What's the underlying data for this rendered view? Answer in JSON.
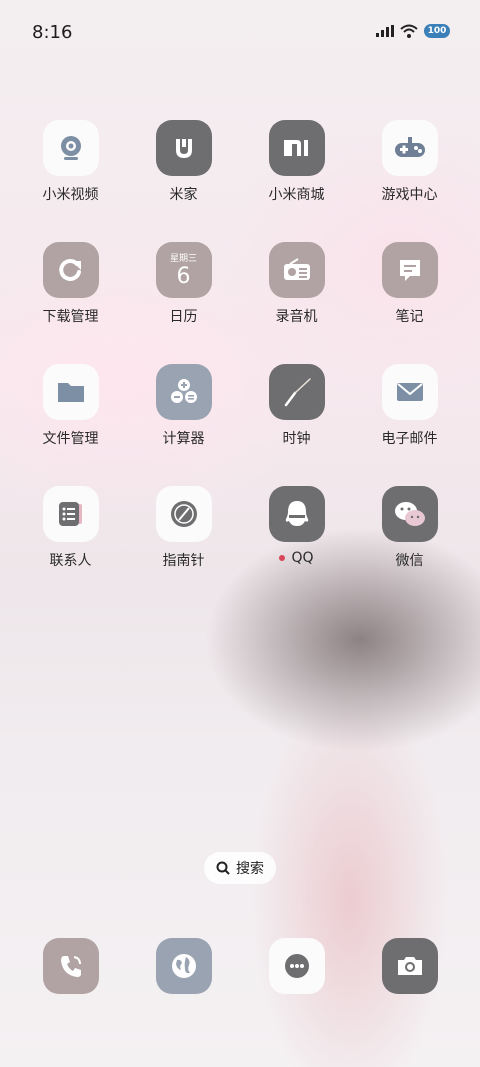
{
  "status": {
    "time": "8:16",
    "battery": "100"
  },
  "apps": [
    {
      "label": "小米视频",
      "icon": "camera-eye-icon"
    },
    {
      "label": "米家",
      "icon": "mijia-logo-icon"
    },
    {
      "label": "小米商城",
      "icon": "mi-logo-icon"
    },
    {
      "label": "游戏中心",
      "icon": "gamepad-icon"
    },
    {
      "label": "下载管理",
      "icon": "refresh-download-icon"
    },
    {
      "label": "日历",
      "icon": "calendar-icon",
      "weekday": "星期三",
      "day": "6"
    },
    {
      "label": "录音机",
      "icon": "radio-recorder-icon"
    },
    {
      "label": "笔记",
      "icon": "note-icon"
    },
    {
      "label": "文件管理",
      "icon": "folder-icon"
    },
    {
      "label": "计算器",
      "icon": "calculator-icon"
    },
    {
      "label": "时钟",
      "icon": "clock-icon"
    },
    {
      "label": "电子邮件",
      "icon": "mail-icon"
    },
    {
      "label": "联系人",
      "icon": "contacts-icon"
    },
    {
      "label": "指南针",
      "icon": "compass-icon"
    },
    {
      "label": "QQ",
      "icon": "qq-penguin-icon"
    },
    {
      "label": "微信",
      "icon": "wechat-icon"
    }
  ],
  "search": {
    "label": "搜索"
  },
  "dock": [
    "phone-icon",
    "browser-globe-icon",
    "messages-icon",
    "camera-icon"
  ]
}
